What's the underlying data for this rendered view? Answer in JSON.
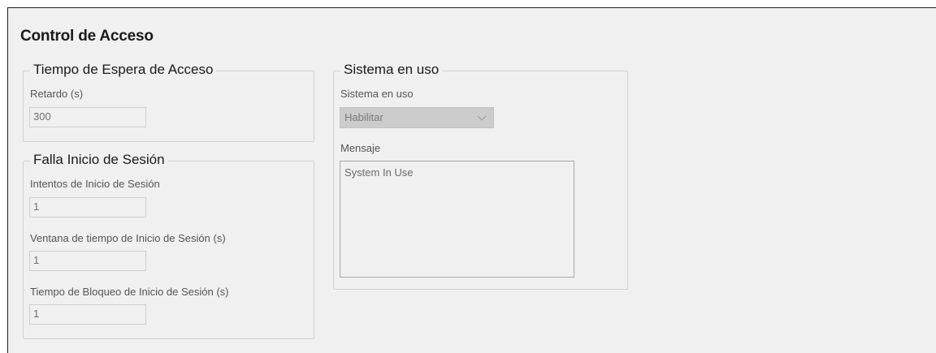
{
  "page": {
    "title": "Control de Acceso"
  },
  "timeout_group": {
    "legend": "Tiempo de Espera de Acceso",
    "delay_label": "Retardo (s)",
    "delay_value": "300"
  },
  "login_failure_group": {
    "legend": "Falla Inicio de Sesión",
    "attempts_label": "Intentos de Inicio de Sesión",
    "attempts_value": "1",
    "window_label": "Ventana de tiempo de Inicio de Sesión (s)",
    "window_value": "1",
    "lockout_label": "Tiempo de Bloqueo de Inicio de Sesión (s)",
    "lockout_value": "1"
  },
  "system_in_use_group": {
    "legend": "Sistema en uso",
    "select_label": "Sistema en uso",
    "select_value": "Habilitar",
    "message_label": "Mensaje",
    "message_value": "System In Use"
  },
  "icons": {
    "dropdown": "chevron-down-icon"
  }
}
